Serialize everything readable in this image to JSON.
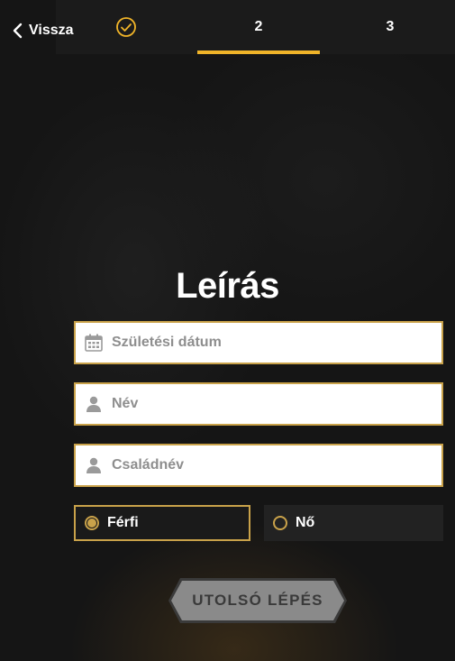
{
  "header": {
    "back_label": "Vissza",
    "steps": [
      {
        "label": "",
        "state": "completed",
        "icon": "check-circle-icon"
      },
      {
        "label": "2",
        "state": "active"
      },
      {
        "label": "3",
        "state": "pending"
      }
    ],
    "accent_color": "#f0b429"
  },
  "form": {
    "title": "Leírás",
    "fields": [
      {
        "placeholder": "Születési dátum",
        "value": "",
        "icon": "calendar-icon"
      },
      {
        "placeholder": "Név",
        "value": "",
        "icon": "person-icon"
      },
      {
        "placeholder": "Családnév",
        "value": "",
        "icon": "person-icon"
      }
    ],
    "gender": {
      "options": [
        "Férfi",
        "Nő"
      ],
      "selected": "Férfi"
    },
    "submit_label": "UTOLSÓ LÉPÉS"
  }
}
